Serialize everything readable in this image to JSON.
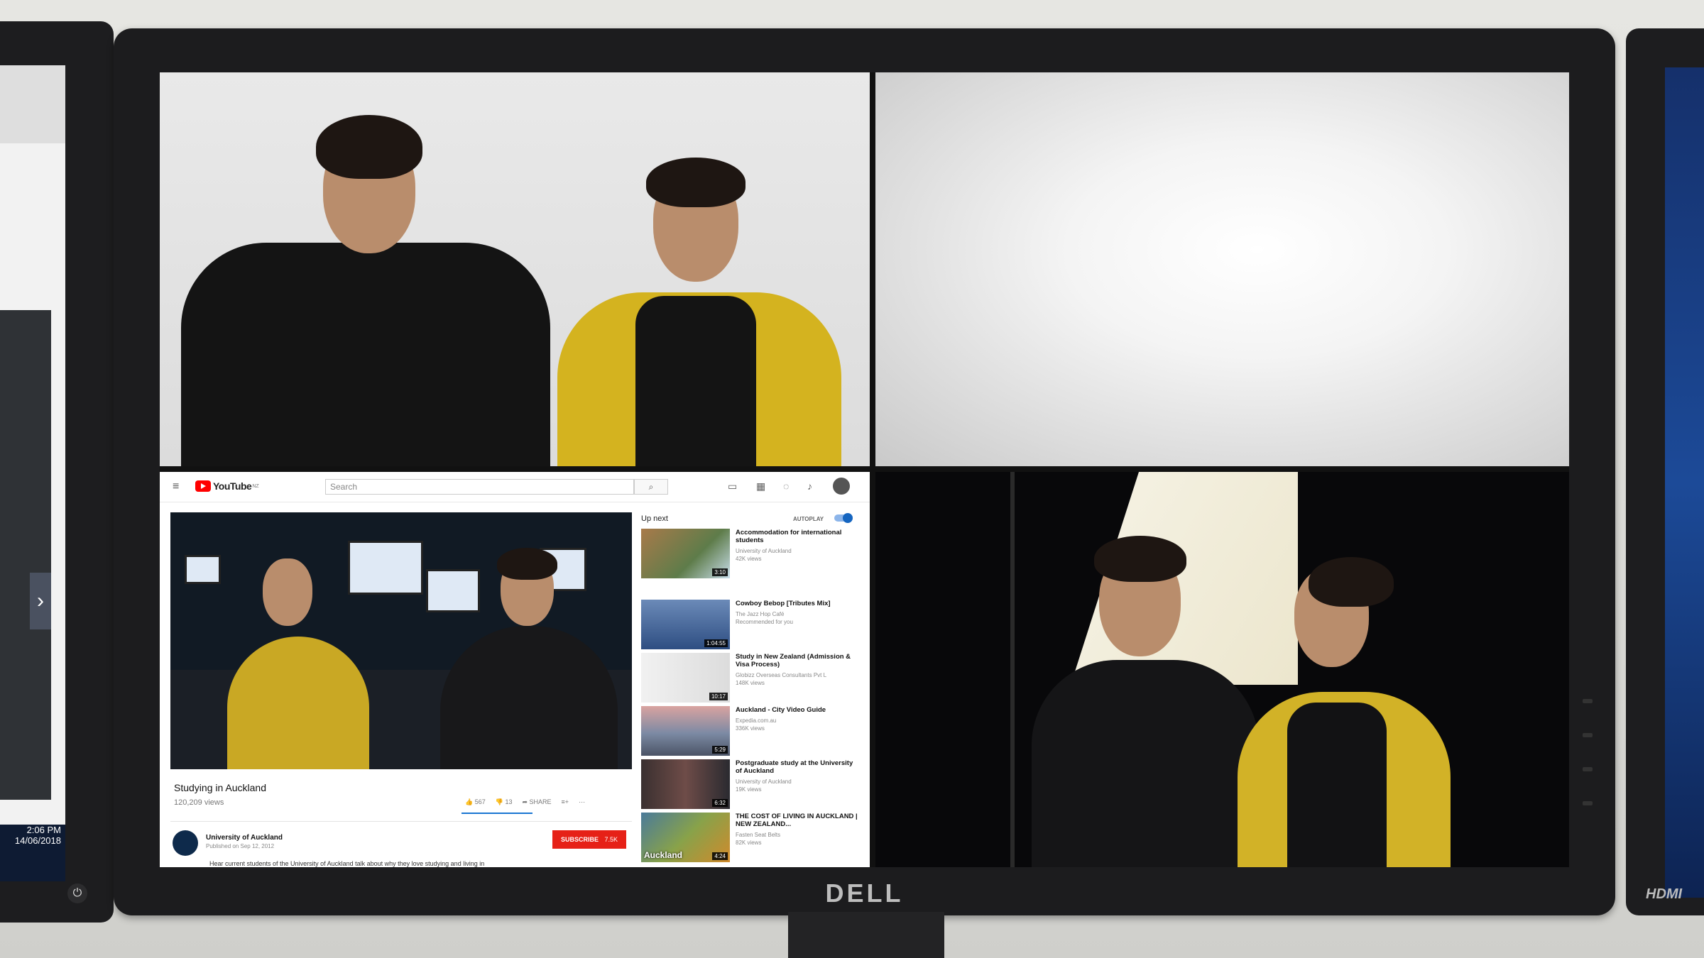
{
  "monitor": {
    "brand": "DELL"
  },
  "left_monitor": {
    "time": "2:06 PM",
    "date": "14/06/2018"
  },
  "youtube": {
    "logo_text": "YouTube",
    "country": "NZ",
    "search_placeholder": "Search",
    "video": {
      "title": "Studying in Auckland",
      "views": "120,209 views",
      "likes": "567",
      "dislikes": "13",
      "share_label": "SHARE",
      "channel": "University of Auckland",
      "published": "Published on Sep 12, 2012",
      "subscribe_label": "SUBSCRIBE",
      "subscriber_count": "7.5K",
      "description": "Hear current students of the University of Auckland talk about why they love studying and living in"
    },
    "up_next_label": "Up next",
    "autoplay_label": "AUTOPLAY",
    "recommendations": [
      {
        "title": "Accommodation for international students",
        "channel": "University of Auckland",
        "views": "42K views",
        "duration": "3:10"
      },
      {
        "title": "Cowboy Bebop [Tributes Mix]",
        "channel": "The Jazz Hop Café",
        "views": "Recommended for you",
        "duration": "1:04:55"
      },
      {
        "title": "Study in New Zealand (Admission & Visa Process)",
        "channel": "Globizz Overseas Consultants Pvt L",
        "views": "148K views",
        "duration": "10:17"
      },
      {
        "title": "Auckland - City Video Guide",
        "channel": "Expedia.com.au",
        "views": "336K views",
        "duration": "5:29"
      },
      {
        "title": "Postgraduate study at the University of Auckland",
        "channel": "University of Auckland",
        "views": "19K views",
        "duration": "6:32"
      },
      {
        "title": "THE COST OF LIVING IN AUCKLAND | NEW ZEALAND...",
        "channel": "Fasten Seat Belts",
        "views": "82K views",
        "duration": "4:24",
        "thumb_text": "Auckland"
      }
    ]
  },
  "colors": {
    "youtube_red": "#ff0000",
    "subscribe_red": "#e62117",
    "autoplay_blue": "#1565c0"
  },
  "right_monitor": {
    "brand": "HDMI"
  }
}
